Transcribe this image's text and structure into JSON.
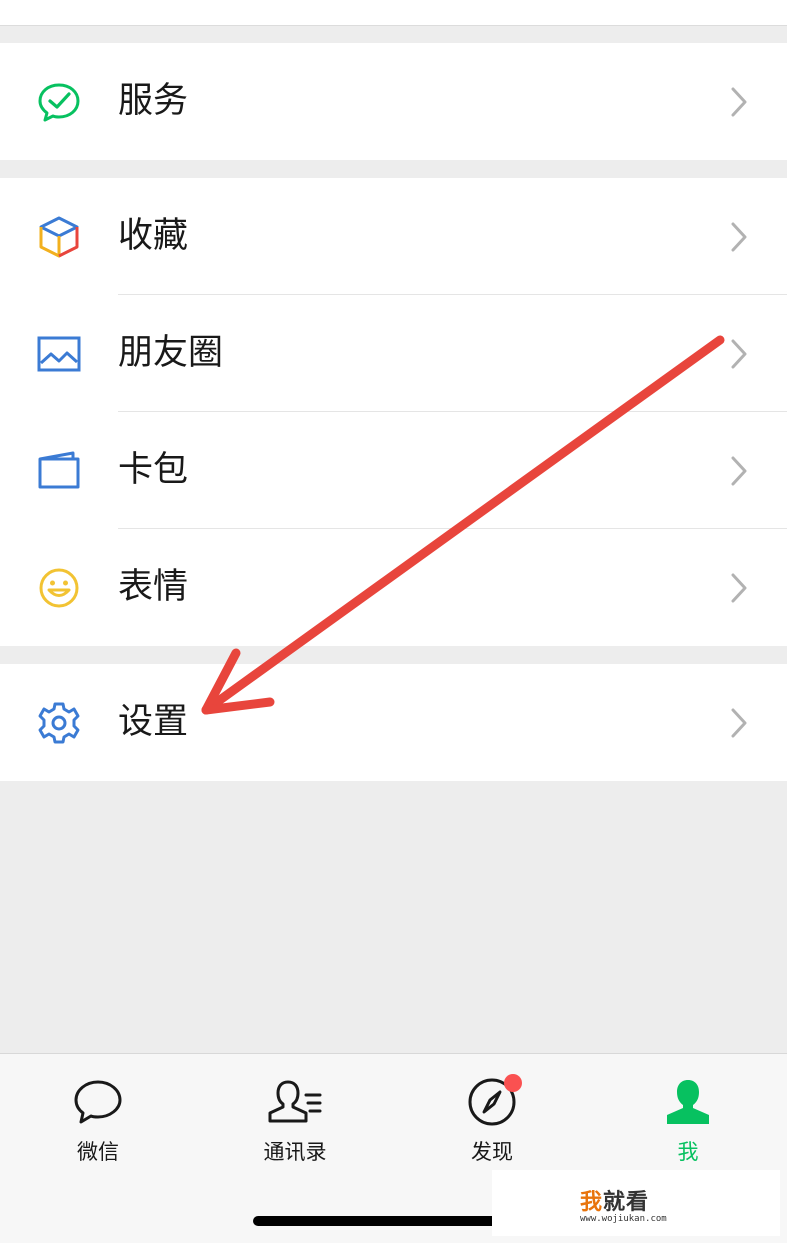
{
  "menu": {
    "service": {
      "label": "服务",
      "icon": "service-icon",
      "color": "#07c160"
    },
    "favorites": {
      "label": "收藏",
      "icon": "favorites-cube-icon"
    },
    "moments": {
      "label": "朋友圈",
      "icon": "moments-photo-icon",
      "color": "#3b7bd4"
    },
    "cards": {
      "label": "卡包",
      "icon": "card-wallet-icon",
      "color": "#3b7bd4"
    },
    "stickers": {
      "label": "表情",
      "icon": "sticker-smile-icon",
      "color": "#f2c333"
    },
    "settings": {
      "label": "设置",
      "icon": "gear-icon",
      "color": "#3b7bd4"
    }
  },
  "annotation": {
    "arrow_color": "#e8453c"
  },
  "tabbar": {
    "tabs": [
      {
        "label": "微信",
        "icon": "chat-bubble-icon",
        "active": false
      },
      {
        "label": "通讯录",
        "icon": "contacts-icon",
        "active": false
      },
      {
        "label": "发现",
        "icon": "compass-icon",
        "active": false,
        "badge": true
      },
      {
        "label": "我",
        "icon": "person-icon",
        "active": true
      }
    ],
    "active_color": "#07c160",
    "badge_color": "#fa5151"
  },
  "watermark": {
    "first_char": "我",
    "rest": "就看",
    "url": "www.wojiukan.com"
  }
}
